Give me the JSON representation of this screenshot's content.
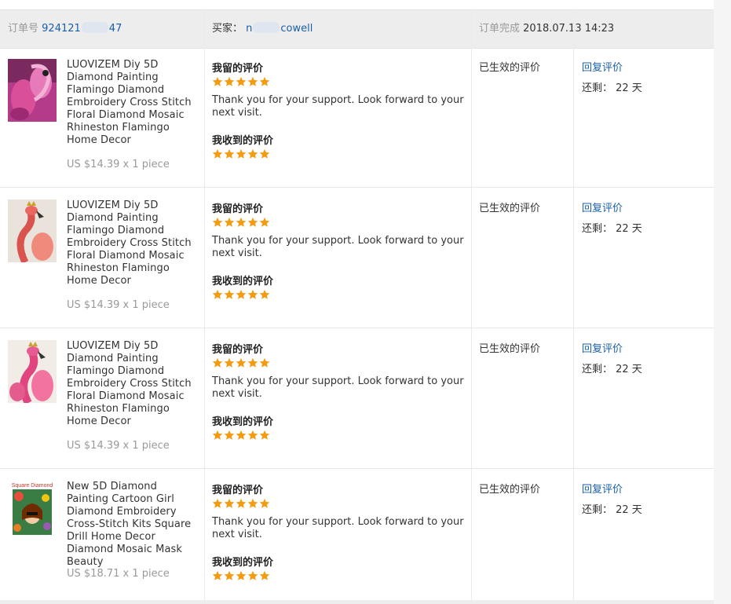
{
  "header": {
    "order_label": "订单号",
    "order_number_visible": "924121",
    "order_number_tail": "47",
    "buyer_label": "买家：",
    "buyer_first": "n",
    "buyer_last": "cowell",
    "done_label": "订单完成",
    "done_time": "2018.07.13 14:23"
  },
  "labels": {
    "my_review": "我留的评价",
    "received_review": "我收到的评价",
    "status": "已生效的评价",
    "reply": "回复评价",
    "remaining": "还剩： 22 天"
  },
  "colors": {
    "star": "#f39c12",
    "link": "#1a5fa6"
  },
  "items": [
    {
      "name": "LUOVIZEM Diy 5D Diamond Painting Flamingo Diamond Embroidery Cross Stitch Floral Diamond Mosaic Rhineston Flamingo Home Decor",
      "price": "US $14.39 x 1 piece",
      "my_stars": 5,
      "my_text": "Thank you for your support. Look forward to your next visit.",
      "received_stars": 5,
      "thumbnail": "pink-flamingo-painting"
    },
    {
      "name": "LUOVIZEM Diy 5D Diamond Painting Flamingo Diamond Embroidery Cross Stitch Floral Diamond Mosaic Rhineston Flamingo Home Decor",
      "price": "US $14.39 x 1 piece",
      "my_stars": 5,
      "my_text": "Thank you for your support. Look forward to your next visit.",
      "received_stars": 5,
      "thumbnail": "crowned-flamingo-painting"
    },
    {
      "name": "LUOVIZEM Diy 5D Diamond Painting Flamingo Diamond Embroidery Cross Stitch Floral Diamond Mosaic Rhineston Flamingo Home Decor",
      "price": "US $14.39 x 1 piece",
      "my_stars": 5,
      "my_text": "Thank you for your support. Look forward to your next visit.",
      "received_stars": 5,
      "thumbnail": "crowned-pink-flamingo-painting"
    },
    {
      "name": "New 5D Diamond Painting Cartoon Girl Diamond Embroidery Cross-Stitch Kits Square Drill Home Decor Diamond Mosaic Mask Beauty",
      "price": "US $18.71 x 1 piece",
      "my_stars": 5,
      "my_text": "Thank you for your support. Look forward to your next visit.",
      "received_stars": 5,
      "thumbnail": "cartoon-girl-painting",
      "thumbnail_caption": "Square Diamond"
    }
  ]
}
